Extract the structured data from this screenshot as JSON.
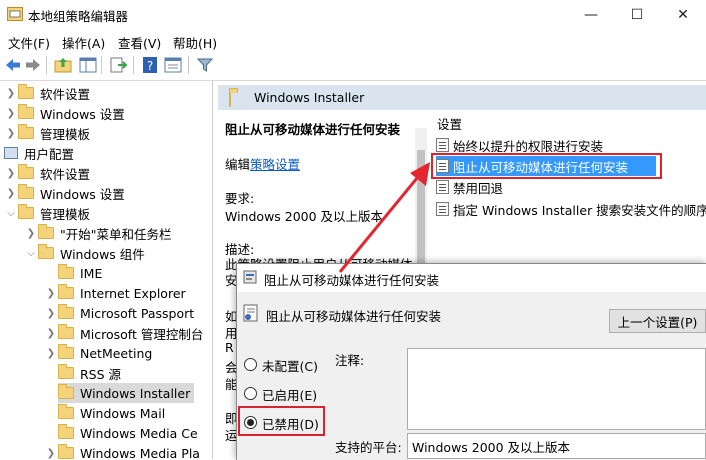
{
  "window": {
    "title": "本地组策略编辑器",
    "controls": {
      "minimize": "—",
      "maximize": "☐",
      "close": "✕"
    }
  },
  "menubar": {
    "items": [
      {
        "label": "文件(F)"
      },
      {
        "label": "操作(A)"
      },
      {
        "label": "查看(V)"
      },
      {
        "label": "帮助(H)"
      }
    ]
  },
  "toolbar": {
    "icons": [
      "back-arrow-icon",
      "forward-arrow-icon",
      "up-folder-icon",
      "show-hide-tree-icon",
      "export-list-icon",
      "help-icon",
      "properties-icon",
      "filter-icon"
    ]
  },
  "tree": {
    "items": [
      {
        "label": "软件设置"
      },
      {
        "label": "Windows 设置"
      },
      {
        "label": "管理模板"
      },
      {
        "label": "用户配置"
      },
      {
        "label": "软件设置"
      },
      {
        "label": "Windows 设置"
      },
      {
        "label": "管理模板"
      },
      {
        "label": "\"开始\"菜单和任务栏"
      },
      {
        "label": "Windows 组件"
      },
      {
        "label": "IME"
      },
      {
        "label": "Internet Explorer"
      },
      {
        "label": "Microsoft Passport"
      },
      {
        "label": "Microsoft 管理控制台"
      },
      {
        "label": "NetMeeting"
      },
      {
        "label": "RSS 源"
      },
      {
        "label": "Windows Installer"
      },
      {
        "label": "Windows Mail"
      },
      {
        "label": "Windows Media Ce"
      },
      {
        "label": "Windows Media Pla"
      }
    ]
  },
  "right_pane": {
    "header": "Windows Installer",
    "description": {
      "title": "阻止从可移动媒体进行任何安装",
      "edit_prefix": "编辑",
      "edit_link": "策略设置",
      "requirements_label": "要求:",
      "requirements_value": "Windows 2000 及以上版本",
      "description_label": "描述:",
      "description_text": "此策略设置阻止用户从可移动媒体",
      "partial_lines": [
        "安",
        "如",
        "用",
        "R",
        "会",
        "能",
        "即",
        "运"
      ]
    },
    "settings_header": "设置",
    "settings": [
      {
        "label": "始终以提升的权限进行安装"
      },
      {
        "label": "阻止从可移动媒体进行任何安装"
      },
      {
        "label": "禁用回退"
      },
      {
        "label": "指定 Windows Installer 搜索安装文件的顺序"
      }
    ]
  },
  "dialog": {
    "title": "阻止从可移动媒体进行任何安装",
    "policy_name": "阻止从可移动媒体进行任何安装",
    "prev_button": "上一个设置(P)",
    "options": [
      {
        "label": "未配置(C)",
        "selected": false
      },
      {
        "label": "已启用(E)",
        "selected": false
      },
      {
        "label": "已禁用(D)",
        "selected": true
      }
    ],
    "comment_label": "注释:",
    "platform_label": "支持的平台:",
    "platform_value": "Windows 2000 及以上版本"
  },
  "colors": {
    "selection": "#3399ff",
    "highlight_box": "#d9232e",
    "pane_header": "#d9e4ef"
  }
}
